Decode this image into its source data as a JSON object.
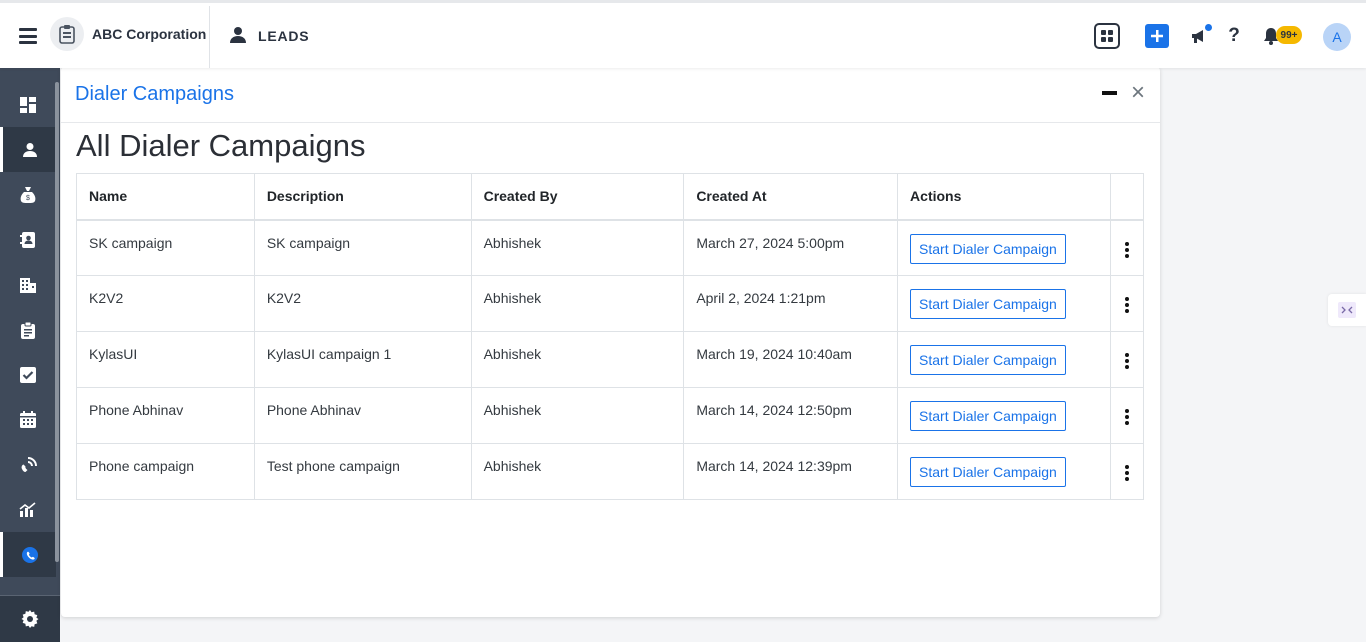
{
  "header": {
    "org_name": "ABC Corporation",
    "module_title": "LEADS",
    "notification_count": "99+",
    "avatar_initial": "A",
    "help_label": "?"
  },
  "panel": {
    "title": "Dialer Campaigns",
    "heading": "All Dialer Campaigns",
    "close_label": "×"
  },
  "table": {
    "columns": [
      "Name",
      "Description",
      "Created By",
      "Created At",
      "Actions"
    ],
    "rows": [
      {
        "name": "SK campaign",
        "description": "SK campaign",
        "created_by": "Abhishek",
        "created_at": "March 27, 2024 5:00pm",
        "action": "Start Dialer Campaign"
      },
      {
        "name": "K2V2",
        "description": "K2V2",
        "created_by": "Abhishek",
        "created_at": "April 2, 2024 1:21pm",
        "action": "Start Dialer Campaign"
      },
      {
        "name": "KylasUI",
        "description": "KylasUI campaign 1",
        "created_by": "Abhishek",
        "created_at": "March 19, 2024 10:40am",
        "action": "Start Dialer Campaign"
      },
      {
        "name": "Phone Abhinav",
        "description": "Phone Abhinav",
        "created_by": "Abhishek",
        "created_at": "March 14, 2024 12:50pm",
        "action": "Start Dialer Campaign"
      },
      {
        "name": "Phone campaign",
        "description": "Test phone campaign",
        "created_by": "Abhishek",
        "created_at": "March 14, 2024 12:39pm",
        "action": "Start Dialer Campaign"
      }
    ]
  },
  "sidebar": {
    "items": [
      "dashboard-icon",
      "leads-icon",
      "deals-icon",
      "contacts-icon",
      "companies-icon",
      "clipboard-icon",
      "tasks-icon",
      "calendar-icon",
      "calls-icon",
      "reports-icon",
      "dialer-icon"
    ],
    "active": "dialer-icon"
  },
  "colors": {
    "accent": "#1a73e8",
    "sidebar": "#3f4a5a",
    "badge": "#f5b800"
  }
}
